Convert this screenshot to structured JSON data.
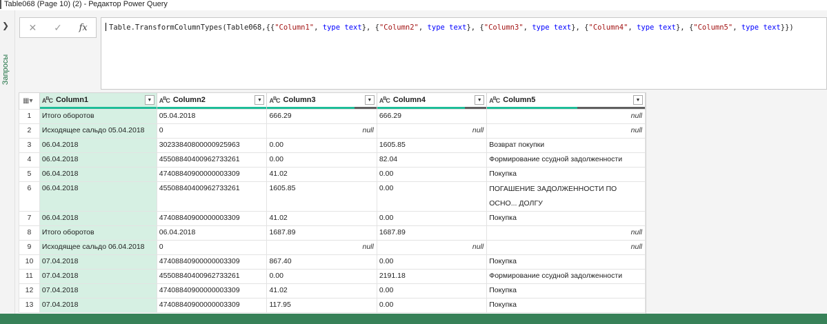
{
  "window": {
    "title": "Table068 (Page 10) (2) - Редактор Power Query"
  },
  "side_pane": {
    "label": "Запросы",
    "expand_icon": "chevron-right-icon"
  },
  "formula_bar": {
    "cancel_icon": "✕",
    "commit_icon": "✓",
    "fx_label": "fx",
    "expression_parts": [
      {
        "t": "Table.TransformColumnTypes(Table068,{{",
        "c": ""
      },
      {
        "t": "\"Column1\"",
        "c": "str"
      },
      {
        "t": ", ",
        "c": ""
      },
      {
        "t": "type text",
        "c": "kw"
      },
      {
        "t": "}, {",
        "c": ""
      },
      {
        "t": "\"Column2\"",
        "c": "str"
      },
      {
        "t": ", ",
        "c": ""
      },
      {
        "t": "type text",
        "c": "kw"
      },
      {
        "t": "}, {",
        "c": ""
      },
      {
        "t": "\"Column3\"",
        "c": "str"
      },
      {
        "t": ", ",
        "c": ""
      },
      {
        "t": "type text",
        "c": "kw"
      },
      {
        "t": "}, {",
        "c": ""
      },
      {
        "t": "\"Column4\"",
        "c": "str"
      },
      {
        "t": ", ",
        "c": ""
      },
      {
        "t": "type text",
        "c": "kw"
      },
      {
        "t": "}, {",
        "c": ""
      },
      {
        "t": "\"Column5\"",
        "c": "str"
      },
      {
        "t": ", ",
        "c": ""
      },
      {
        "t": "type text",
        "c": "kw"
      },
      {
        "t": "}})",
        "c": ""
      }
    ]
  },
  "grid": {
    "columns": [
      {
        "name": "Column1",
        "quality": {
          "valid": 1.0,
          "error": 0.0,
          "empty": 0.0
        }
      },
      {
        "name": "Column2",
        "quality": {
          "valid": 1.0,
          "error": 0.0,
          "empty": 0.0
        }
      },
      {
        "name": "Column3",
        "quality": {
          "valid": 0.8,
          "error": 0.0,
          "empty": 0.2
        }
      },
      {
        "name": "Column4",
        "quality": {
          "valid": 0.8,
          "error": 0.0,
          "empty": 0.2
        }
      },
      {
        "name": "Column5",
        "quality": {
          "valid": 0.57,
          "error": 0.0,
          "empty": 0.43
        }
      }
    ],
    "type_icon": {
      "a": "A",
      "b": "B",
      "c": "C"
    },
    "rows": [
      {
        "n": "1",
        "cells": [
          "Итого оборотов",
          "05.04.2018",
          "666.29",
          "666.29",
          "null"
        ]
      },
      {
        "n": "2",
        "cells": [
          "Исходящее сальдо 05.04.2018",
          "0",
          "null",
          "null",
          "null"
        ]
      },
      {
        "n": "3",
        "cells": [
          "06.04.2018",
          "30233840800000925963",
          "0.00",
          "1605.85",
          "Возврат покупки"
        ]
      },
      {
        "n": "4",
        "cells": [
          "06.04.2018",
          "45508840400962733261",
          "0.00",
          "82.04",
          "Формирование ссудной задолженности"
        ]
      },
      {
        "n": "5",
        "cells": [
          "06.04.2018",
          "47408840900000003309",
          "41.02",
          "0.00",
          "Покупка"
        ]
      },
      {
        "n": "6",
        "cells": [
          "06.04.2018",
          "45508840400962733261",
          "1605.85",
          "0.00",
          "ПОГАШЕНИЕ ЗАДОЛЖЕННОСТИ ПО ОСНО... ДОЛГУ"
        ]
      },
      {
        "n": "7",
        "cells": [
          "06.04.2018",
          "47408840900000003309",
          "41.02",
          "0.00",
          "Покупка"
        ]
      },
      {
        "n": "8",
        "cells": [
          "Итого оборотов",
          "06.04.2018",
          "1687.89",
          "1687.89",
          "null"
        ]
      },
      {
        "n": "9",
        "cells": [
          "Исходящее сальдо 06.04.2018",
          "0",
          "null",
          "null",
          "null"
        ]
      },
      {
        "n": "10",
        "cells": [
          "07.04.2018",
          "47408840900000003309",
          "867.40",
          "0.00",
          "Покупка"
        ]
      },
      {
        "n": "11",
        "cells": [
          "07.04.2018",
          "45508840400962733261",
          "0.00",
          "2191.18",
          "Формирование ссудной задолженности"
        ]
      },
      {
        "n": "12",
        "cells": [
          "07.04.2018",
          "47408840900000003309",
          "41.02",
          "0.00",
          "Покупка"
        ]
      },
      {
        "n": "13",
        "cells": [
          "07.04.2018",
          "47408840900000003309",
          "117.95",
          "0.00",
          "Покупка"
        ]
      }
    ],
    "tall_rows": [
      "6"
    ],
    "null_text": "null"
  },
  "colors": {
    "selected_column": "#d6f0e3",
    "quality_valid": "#1ebd98",
    "quality_empty": "#5f5f5f",
    "keyword": "#0000ff",
    "string": "#a31515"
  }
}
